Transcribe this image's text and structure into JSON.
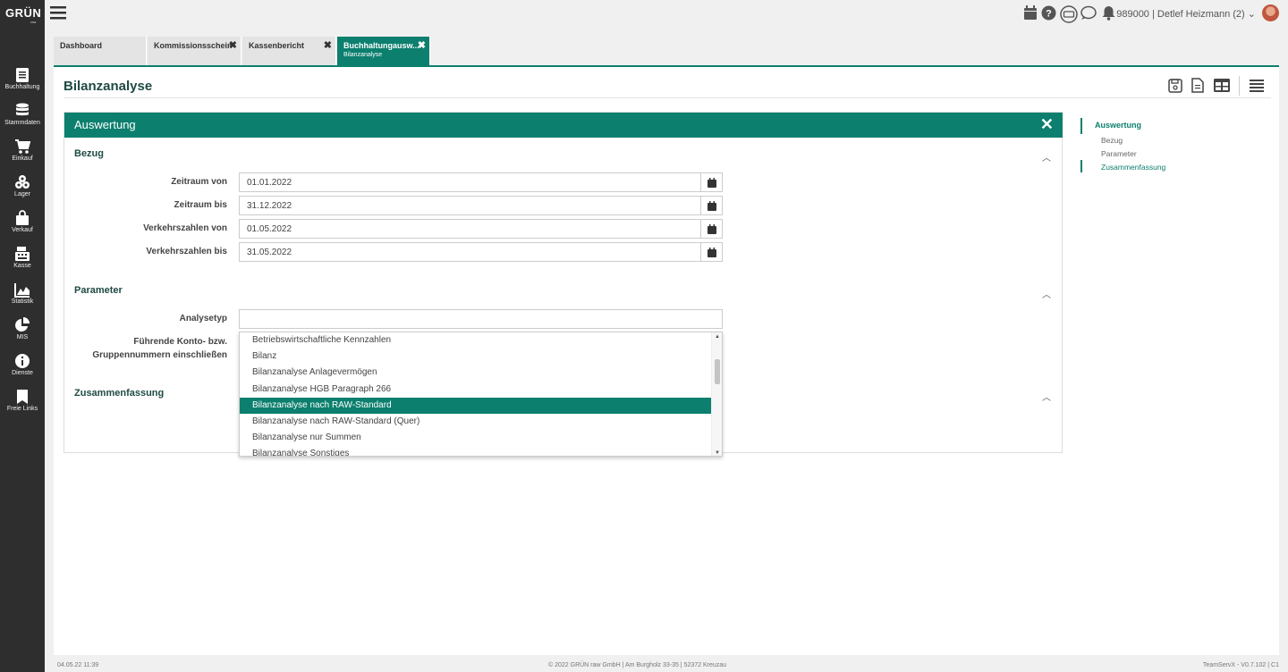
{
  "app": {
    "logo": "GRÜN",
    "logo_sub": "raw"
  },
  "sidebar": {
    "items": [
      {
        "label": "Buchhaltung",
        "icon": "ledger-icon"
      },
      {
        "label": "Stammdaten",
        "icon": "database-icon"
      },
      {
        "label": "Einkauf",
        "icon": "cart-icon"
      },
      {
        "label": "Lager",
        "icon": "boxes-icon"
      },
      {
        "label": "Verkauf",
        "icon": "shopping-bag-icon"
      },
      {
        "label": "Kasse",
        "icon": "cash-register-icon"
      },
      {
        "label": "Statistik",
        "icon": "area-chart-icon"
      },
      {
        "label": "MIS",
        "icon": "pie-chart-icon"
      },
      {
        "label": "Dienste",
        "icon": "info-icon"
      },
      {
        "label": "Freie Links",
        "icon": "bookmark-icon"
      }
    ]
  },
  "topbar": {
    "user": "989000 | Detlef Heizmann (2)"
  },
  "tabs": [
    {
      "label": "Dashboard",
      "sub": "",
      "closable": false,
      "active": false
    },
    {
      "label": "Kommissionsschein",
      "sub": "",
      "closable": true,
      "active": false
    },
    {
      "label": "Kassenbericht",
      "sub": "",
      "closable": true,
      "active": false
    },
    {
      "label": "Buchhaltungausw...",
      "sub": "Bilanzanalyse",
      "closable": true,
      "active": true
    }
  ],
  "page": {
    "title": "Bilanzanalyse"
  },
  "panel": {
    "title": "Auswertung",
    "sections": {
      "bezug": "Bezug",
      "parameter": "Parameter",
      "zusammenfassung": "Zusammenfassung"
    },
    "fields": [
      {
        "label": "Zeitraum von",
        "value": "01.01.2022"
      },
      {
        "label": "Zeitraum bis",
        "value": "31.12.2022"
      },
      {
        "label": "Verkehrszahlen von",
        "value": "01.05.2022"
      },
      {
        "label": "Verkehrszahlen bis",
        "value": "31.05.2022"
      }
    ],
    "analysetyp": {
      "label": "Analysetyp",
      "value": ""
    },
    "fuehrende": {
      "label": "Führende Konto- bzw. Gruppennummern einschließen"
    },
    "dropdown": {
      "options": [
        "Betriebswirtschaftliche Kennzahlen",
        "Bilanz",
        "Bilanzanalyse Anlagevermögen",
        "Bilanzanalyse HGB Paragraph 266",
        "Bilanzanalyse nach RAW-Standard",
        "Bilanzanalyse nach RAW-Standard (Quer)",
        "Bilanzanalyse nur Summen",
        "Bilanzanalyse Sonstiges"
      ],
      "selected_index": 4
    }
  },
  "nav": {
    "items": [
      {
        "label": "Auswertung",
        "level": 0,
        "active": true
      },
      {
        "label": "Bezug",
        "level": 1,
        "active": false
      },
      {
        "label": "Parameter",
        "level": 1,
        "active": false
      },
      {
        "label": "Zusammenfassung",
        "level": 1,
        "active": true
      }
    ]
  },
  "footer": {
    "left": "04.05.22 11:39",
    "center": "© 2022 GRÜN raw GmbH | Am Burgholz 33-35 | 52372 Kreuzau",
    "right": "TeamServX - V0.7.102 | C1"
  },
  "colors": {
    "accent": "#0c7f6e",
    "sidebar": "#2e2e2e",
    "title": "#1f4a44"
  }
}
